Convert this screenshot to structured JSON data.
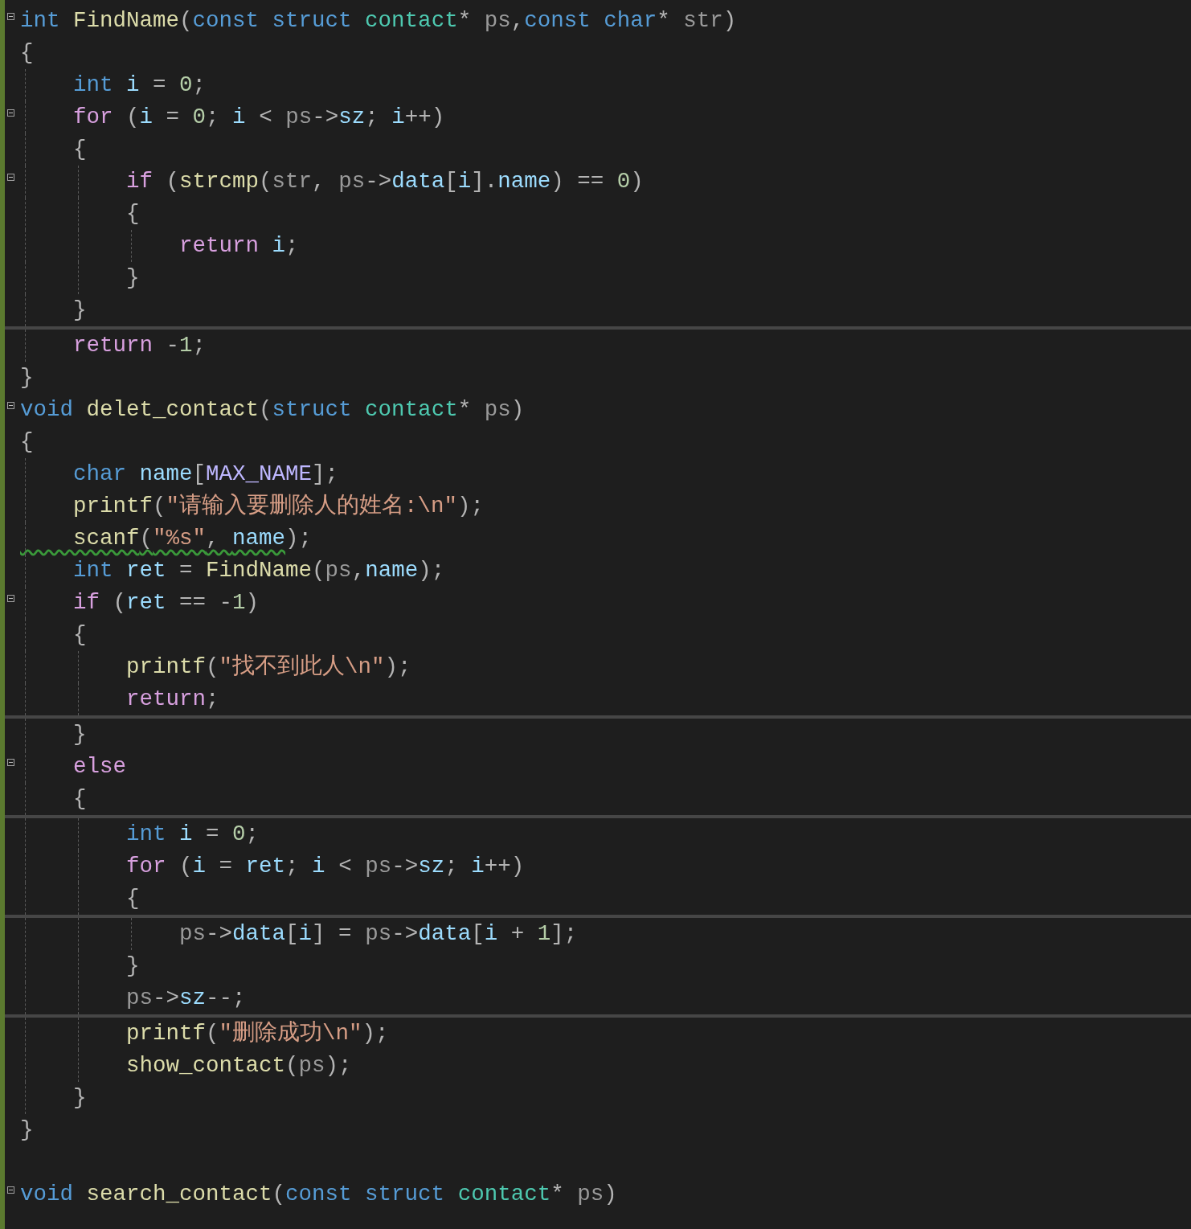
{
  "editor": {
    "segments": [
      {
        "lines": [
          {
            "fold": true,
            "tokens": [
              {
                "kind": "kw",
                "text": "int"
              },
              {
                "kind": "fn",
                "text": " FindName"
              },
              {
                "kind": "p",
                "text": "("
              },
              {
                "kind": "kw",
                "text": "const"
              },
              {
                "kind": "kw",
                "text": " struct"
              },
              {
                "kind": "type",
                "text": " contact"
              },
              {
                "kind": "p",
                "text": "* "
              },
              {
                "kind": "param",
                "text": "ps"
              },
              {
                "kind": "p",
                "text": ","
              },
              {
                "kind": "kw",
                "text": "const"
              },
              {
                "kind": "kw",
                "text": " char"
              },
              {
                "kind": "p",
                "text": "* "
              },
              {
                "kind": "param",
                "text": "str"
              },
              {
                "kind": "p",
                "text": ")"
              }
            ]
          },
          {
            "fold": false,
            "tokens": [
              {
                "kind": "p",
                "text": "{"
              }
            ]
          },
          {
            "fold": false,
            "tokens": [
              {
                "kind": "kw",
                "text": "    int"
              },
              {
                "kind": "var",
                "text": " i"
              },
              {
                "kind": "p",
                "text": " = "
              },
              {
                "kind": "num",
                "text": "0"
              },
              {
                "kind": "p",
                "text": ";"
              }
            ]
          },
          {
            "fold": true,
            "tokens": [
              {
                "kind": "ctl",
                "text": "    for"
              },
              {
                "kind": "p",
                "text": " ("
              },
              {
                "kind": "var",
                "text": "i"
              },
              {
                "kind": "p",
                "text": " = "
              },
              {
                "kind": "num",
                "text": "0"
              },
              {
                "kind": "p",
                "text": "; "
              },
              {
                "kind": "var",
                "text": "i"
              },
              {
                "kind": "p",
                "text": " < "
              },
              {
                "kind": "param",
                "text": "ps"
              },
              {
                "kind": "p",
                "text": "->"
              },
              {
                "kind": "var",
                "text": "sz"
              },
              {
                "kind": "p",
                "text": "; "
              },
              {
                "kind": "var",
                "text": "i"
              },
              {
                "kind": "p",
                "text": "++)"
              }
            ]
          },
          {
            "fold": false,
            "tokens": [
              {
                "kind": "p",
                "text": "    {"
              }
            ]
          },
          {
            "fold": true,
            "tokens": [
              {
                "kind": "ctl",
                "text": "        if"
              },
              {
                "kind": "p",
                "text": " ("
              },
              {
                "kind": "fn",
                "text": "strcmp"
              },
              {
                "kind": "p",
                "text": "("
              },
              {
                "kind": "param",
                "text": "str"
              },
              {
                "kind": "p",
                "text": ", "
              },
              {
                "kind": "param",
                "text": "ps"
              },
              {
                "kind": "p",
                "text": "->"
              },
              {
                "kind": "var",
                "text": "data"
              },
              {
                "kind": "p",
                "text": "["
              },
              {
                "kind": "var",
                "text": "i"
              },
              {
                "kind": "p",
                "text": "]."
              },
              {
                "kind": "var",
                "text": "name"
              },
              {
                "kind": "p",
                "text": ") == "
              },
              {
                "kind": "num",
                "text": "0"
              },
              {
                "kind": "p",
                "text": ")"
              }
            ]
          },
          {
            "fold": false,
            "tokens": [
              {
                "kind": "p",
                "text": "        {"
              }
            ]
          },
          {
            "fold": false,
            "tokens": [
              {
                "kind": "ctl",
                "text": "            return"
              },
              {
                "kind": "var",
                "text": " i"
              },
              {
                "kind": "p",
                "text": ";"
              }
            ]
          },
          {
            "fold": false,
            "tokens": [
              {
                "kind": "p",
                "text": "        }"
              }
            ]
          },
          {
            "fold": false,
            "tokens": [
              {
                "kind": "p",
                "text": "    }"
              }
            ]
          }
        ]
      },
      {
        "lines": [
          {
            "fold": false,
            "tokens": [
              {
                "kind": "ctl",
                "text": "    return"
              },
              {
                "kind": "p",
                "text": " -"
              },
              {
                "kind": "num",
                "text": "1"
              },
              {
                "kind": "p",
                "text": ";"
              }
            ]
          },
          {
            "fold": false,
            "tokens": [
              {
                "kind": "p",
                "text": "}"
              }
            ]
          },
          {
            "fold": true,
            "tokens": [
              {
                "kind": "kw",
                "text": "void"
              },
              {
                "kind": "fn",
                "text": " delet_contact"
              },
              {
                "kind": "p",
                "text": "("
              },
              {
                "kind": "kw",
                "text": "struct"
              },
              {
                "kind": "type",
                "text": " contact"
              },
              {
                "kind": "p",
                "text": "* "
              },
              {
                "kind": "param",
                "text": "ps"
              },
              {
                "kind": "p",
                "text": ")"
              }
            ]
          },
          {
            "fold": false,
            "tokens": [
              {
                "kind": "p",
                "text": "{"
              }
            ]
          },
          {
            "fold": false,
            "tokens": [
              {
                "kind": "kw",
                "text": "    char"
              },
              {
                "kind": "var",
                "text": " name"
              },
              {
                "kind": "p",
                "text": "["
              },
              {
                "kind": "macro",
                "text": "MAX_NAME"
              },
              {
                "kind": "p",
                "text": "];"
              }
            ]
          },
          {
            "fold": false,
            "tokens": [
              {
                "kind": "fn",
                "text": "    printf"
              },
              {
                "kind": "p",
                "text": "("
              },
              {
                "kind": "str",
                "text": "\"请输入要删除人的姓名:\\n\""
              },
              {
                "kind": "p",
                "text": ");"
              }
            ]
          },
          {
            "fold": false,
            "tokens": [
              {
                "kind": "fn",
                "text": "    scanf",
                "warn": true
              },
              {
                "kind": "p",
                "text": "(",
                "warn": true
              },
              {
                "kind": "str",
                "text": "\"%s\"",
                "warn": true
              },
              {
                "kind": "p",
                "text": ", ",
                "warn": true
              },
              {
                "kind": "var",
                "text": "name",
                "warn": true
              },
              {
                "kind": "p",
                "text": ");"
              }
            ]
          },
          {
            "fold": false,
            "tokens": [
              {
                "kind": "kw",
                "text": "    int"
              },
              {
                "kind": "var",
                "text": " ret"
              },
              {
                "kind": "p",
                "text": " = "
              },
              {
                "kind": "fn",
                "text": "FindName"
              },
              {
                "kind": "p",
                "text": "("
              },
              {
                "kind": "param",
                "text": "ps"
              },
              {
                "kind": "p",
                "text": ","
              },
              {
                "kind": "var",
                "text": "name"
              },
              {
                "kind": "p",
                "text": ");"
              }
            ]
          },
          {
            "fold": true,
            "tokens": [
              {
                "kind": "ctl",
                "text": "    if"
              },
              {
                "kind": "p",
                "text": " ("
              },
              {
                "kind": "var",
                "text": "ret"
              },
              {
                "kind": "p",
                "text": " == -"
              },
              {
                "kind": "num",
                "text": "1"
              },
              {
                "kind": "p",
                "text": ")"
              }
            ]
          },
          {
            "fold": false,
            "tokens": [
              {
                "kind": "p",
                "text": "    {"
              }
            ]
          },
          {
            "fold": false,
            "tokens": [
              {
                "kind": "fn",
                "text": "        printf"
              },
              {
                "kind": "p",
                "text": "("
              },
              {
                "kind": "str",
                "text": "\"找不到此人\\n\""
              },
              {
                "kind": "p",
                "text": ");"
              }
            ]
          },
          {
            "fold": false,
            "tokens": [
              {
                "kind": "ctl",
                "text": "        return"
              },
              {
                "kind": "p",
                "text": ";"
              }
            ]
          }
        ]
      },
      {
        "lines": [
          {
            "fold": false,
            "tokens": [
              {
                "kind": "p",
                "text": "    }"
              }
            ]
          },
          {
            "fold": true,
            "tokens": [
              {
                "kind": "ctl",
                "text": "    else"
              }
            ]
          },
          {
            "fold": false,
            "tokens": [
              {
                "kind": "p",
                "text": "    {"
              }
            ]
          }
        ]
      },
      {
        "lines": [
          {
            "fold": false,
            "tokens": [
              {
                "kind": "kw",
                "text": "        int"
              },
              {
                "kind": "var",
                "text": " i"
              },
              {
                "kind": "p",
                "text": " = "
              },
              {
                "kind": "num",
                "text": "0"
              },
              {
                "kind": "p",
                "text": ";"
              }
            ]
          },
          {
            "fold": false,
            "tokens": [
              {
                "kind": "ctl",
                "text": "        for"
              },
              {
                "kind": "p",
                "text": " ("
              },
              {
                "kind": "var",
                "text": "i"
              },
              {
                "kind": "p",
                "text": " = "
              },
              {
                "kind": "var",
                "text": "ret"
              },
              {
                "kind": "p",
                "text": "; "
              },
              {
                "kind": "var",
                "text": "i"
              },
              {
                "kind": "p",
                "text": " < "
              },
              {
                "kind": "param",
                "text": "ps"
              },
              {
                "kind": "p",
                "text": "->"
              },
              {
                "kind": "var",
                "text": "sz"
              },
              {
                "kind": "p",
                "text": "; "
              },
              {
                "kind": "var",
                "text": "i"
              },
              {
                "kind": "p",
                "text": "++)"
              }
            ]
          },
          {
            "fold": false,
            "tokens": [
              {
                "kind": "p",
                "text": "        {"
              }
            ]
          }
        ]
      },
      {
        "lines": [
          {
            "fold": false,
            "tokens": [
              {
                "kind": "param",
                "text": "            ps"
              },
              {
                "kind": "p",
                "text": "->"
              },
              {
                "kind": "var",
                "text": "data"
              },
              {
                "kind": "p",
                "text": "["
              },
              {
                "kind": "var",
                "text": "i"
              },
              {
                "kind": "p",
                "text": "] = "
              },
              {
                "kind": "param",
                "text": "ps"
              },
              {
                "kind": "p",
                "text": "->"
              },
              {
                "kind": "var",
                "text": "data"
              },
              {
                "kind": "p",
                "text": "["
              },
              {
                "kind": "var",
                "text": "i"
              },
              {
                "kind": "p",
                "text": " + "
              },
              {
                "kind": "num",
                "text": "1"
              },
              {
                "kind": "p",
                "text": "];"
              }
            ]
          },
          {
            "fold": false,
            "tokens": [
              {
                "kind": "p",
                "text": "        }"
              }
            ]
          },
          {
            "fold": false,
            "tokens": [
              {
                "kind": "param",
                "text": "        ps"
              },
              {
                "kind": "p",
                "text": "->"
              },
              {
                "kind": "var",
                "text": "sz"
              },
              {
                "kind": "p",
                "text": "--;"
              }
            ]
          }
        ]
      },
      {
        "lines": [
          {
            "fold": false,
            "tokens": [
              {
                "kind": "fn",
                "text": "        printf"
              },
              {
                "kind": "p",
                "text": "("
              },
              {
                "kind": "str",
                "text": "\"删除成功\\n\""
              },
              {
                "kind": "p",
                "text": ");"
              }
            ]
          },
          {
            "fold": false,
            "tokens": [
              {
                "kind": "fn",
                "text": "        show_contact"
              },
              {
                "kind": "p",
                "text": "("
              },
              {
                "kind": "param",
                "text": "ps"
              },
              {
                "kind": "p",
                "text": ");"
              }
            ]
          },
          {
            "fold": false,
            "tokens": [
              {
                "kind": "p",
                "text": "    }"
              }
            ]
          },
          {
            "fold": false,
            "tokens": [
              {
                "kind": "p",
                "text": "}"
              }
            ]
          },
          {
            "fold": false
          },
          {
            "fold": true,
            "tokens": [
              {
                "kind": "kw",
                "text": "void"
              },
              {
                "kind": "fn",
                "text": " search_contact"
              },
              {
                "kind": "p",
                "text": "("
              },
              {
                "kind": "kw",
                "text": "const"
              },
              {
                "kind": "kw",
                "text": " struct"
              },
              {
                "kind": "type",
                "text": " contact"
              },
              {
                "kind": "p",
                "text": "* "
              },
              {
                "kind": "param",
                "text": "ps"
              },
              {
                "kind": "p",
                "text": ")"
              }
            ]
          }
        ]
      }
    ]
  }
}
